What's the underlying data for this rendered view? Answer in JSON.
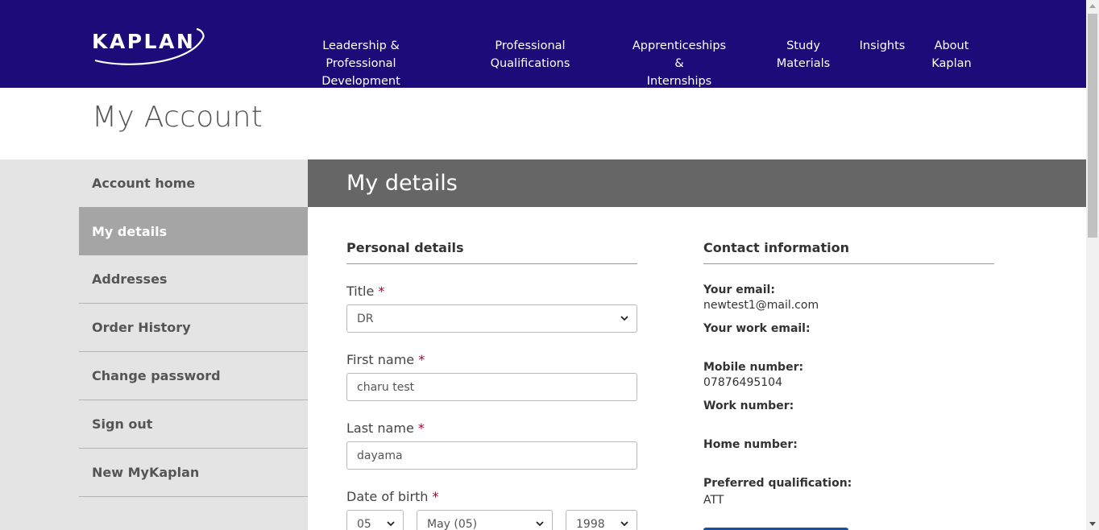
{
  "brand": {
    "logo_text": "KAPLAN"
  },
  "nav": [
    {
      "line1": "Leadership & Professional",
      "line2": "Development"
    },
    {
      "line1": "Professional",
      "line2": "Qualifications"
    },
    {
      "line1": "Apprenticeships &",
      "line2": "Internships"
    },
    {
      "line1": "Study",
      "line2": "Materials"
    },
    {
      "line1": "Insights",
      "line2": ""
    },
    {
      "line1": "About",
      "line2": "Kaplan"
    }
  ],
  "page_title": "My Account",
  "sidebar": {
    "items": [
      {
        "label": "Account home"
      },
      {
        "label": "My details"
      },
      {
        "label": "Addresses"
      },
      {
        "label": "Order History"
      },
      {
        "label": "Change password"
      },
      {
        "label": "Sign out"
      },
      {
        "label": "New MyKaplan"
      }
    ]
  },
  "main": {
    "heading": "My details",
    "personal": {
      "title": "Personal details",
      "title_label": "Title",
      "title_value": "DR",
      "first_name_label": "First name",
      "first_name_value": "charu test",
      "last_name_label": "Last name",
      "last_name_value": "dayama",
      "dob_label": "Date of birth",
      "dob_day": "05",
      "dob_month": "May (05)",
      "dob_year": "1998",
      "required_mark": "*"
    },
    "contact": {
      "title": "Contact information",
      "email_label": "Your email:",
      "email_value": "newtest1@mail.com",
      "work_email_label": "Your work email:",
      "mobile_label": "Mobile number:",
      "mobile_value": "07876495104",
      "work_number_label": "Work number:",
      "home_number_label": "Home number:",
      "preferred_label": "Preferred qualification:",
      "preferred_value": "ATT"
    }
  },
  "colors": {
    "header_bg": "#1e0b7a",
    "sidebar_bg": "#e3e4e3",
    "active_item": "#a5a5a5",
    "section_header": "#666666",
    "required": "#a0003c",
    "button": "#1a4f9c"
  }
}
